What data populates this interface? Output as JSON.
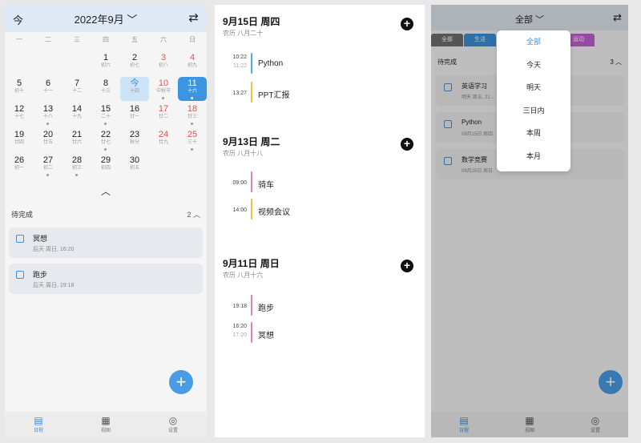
{
  "calendar_view": {
    "today_button": "今",
    "month_title": "2022年9月",
    "title_chevron": "﹀",
    "swap_icon": "⇄",
    "weekdays": [
      "一",
      "二",
      "三",
      "四",
      "五",
      "六",
      "日"
    ],
    "collapse_arrow": "︿",
    "pending_label": "待完成",
    "pending_count": "2 ︿",
    "tasks": [
      {
        "title": "冥想",
        "sub": "后天 周日, 16:20"
      },
      {
        "title": "跑步",
        "sub": "后天 周日, 19:18"
      }
    ],
    "fab": "+",
    "tabs": [
      "日程",
      "视图",
      "设置"
    ]
  },
  "colors": {
    "accent": "#3b95e0",
    "weekend": "#d9534f",
    "event_python": "#4ab0e8",
    "event_ppt": "#f0c040",
    "event_bike": "#e080c0",
    "event_meeting": "#f0c040",
    "event_run": "#e080c0",
    "event_meditate": "#e080c0"
  },
  "agenda_view": {
    "groups": [
      {
        "date": "9月15日 周四",
        "lunar": "农历 八月二十",
        "add": "+",
        "events": [
          {
            "start": "10:22",
            "end": "11:22",
            "name": "Python",
            "color": "#4ab0e8"
          },
          {
            "start": "13:27",
            "end": "",
            "name": "PPT汇报",
            "color": "#f0c040"
          }
        ]
      },
      {
        "date": "9月13日 周二",
        "lunar": "农历 八月十八",
        "add": "+",
        "events": [
          {
            "start": "09:00",
            "end": "",
            "name": "骑车",
            "color": "#e080c0"
          },
          {
            "start": "14:00",
            "end": "",
            "name": "视频会议",
            "color": "#f0c040"
          }
        ]
      },
      {
        "date": "9月11日 周日",
        "lunar": "农历 八月十六",
        "add": "+",
        "events": [
          {
            "start": "19:18",
            "end": "",
            "name": "跑步",
            "color": "#e080c0"
          },
          {
            "start": "16:20",
            "end": "17:20",
            "name": "冥想",
            "color": "#e080c0"
          }
        ]
      }
    ]
  },
  "list_view": {
    "title": "全部",
    "title_chevron": "﹀",
    "swap_icon": "⇄",
    "categories": [
      {
        "label": "全部",
        "color": "#6e6e6e"
      },
      {
        "label": "生活",
        "color": "#3b8fd8"
      },
      {
        "label": "",
        "color": "#e0a030"
      },
      {
        "label": "",
        "color": "#e2b840"
      },
      {
        "label": "运动",
        "color": "#c060d0"
      }
    ],
    "pending_label": "待完成",
    "pending_count": "3 ︿",
    "tasks": [
      {
        "title": "英语学习",
        "sub": "明天 周五, 21:..."
      },
      {
        "title": "Python",
        "sub": "09月15日 周四"
      },
      {
        "title": "数学竞赛",
        "sub": "09月25日 周日"
      }
    ],
    "dropdown": [
      "全部",
      "今天",
      "明天",
      "三日内",
      "本周",
      "本月"
    ],
    "fab": "+",
    "tabs": [
      "日程",
      "视图",
      "设置"
    ]
  }
}
